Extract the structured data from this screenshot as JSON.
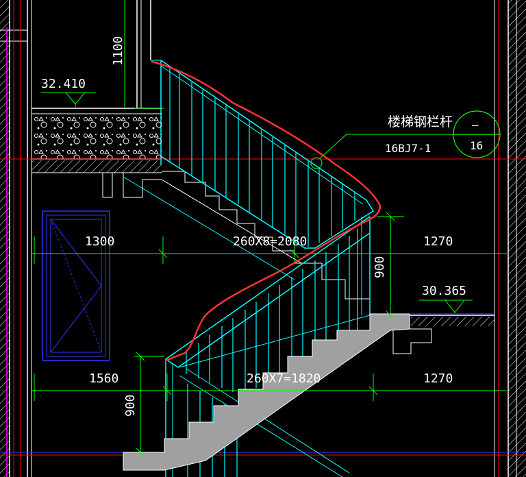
{
  "drawing": {
    "dimensions": {
      "upper_height": "1100",
      "upper_left_width": "1300",
      "upper_flight": "260X8=2080",
      "upper_right_width": "1270",
      "rail_height_mid": "900",
      "lower_left_width": "1560",
      "lower_flight": "260X7=1820",
      "lower_right_width": "1270",
      "rail_height_low": "900"
    },
    "levels": {
      "upper": "32.410",
      "lower": "30.365"
    },
    "callout": {
      "label": "楼梯钢栏杆",
      "spec": "16BJ7-1",
      "detail_number": "—",
      "sheet_number": "16"
    },
    "colors": {
      "background": "#000000",
      "wall": "#ffffff",
      "dimension": "#00ff00",
      "railing": "#00ffff",
      "axis": "#ff0000",
      "markup": "#ff3333",
      "magenta": "#ff00ff",
      "window": "#3333ff",
      "stair_fill": "#a0a0a0"
    }
  }
}
